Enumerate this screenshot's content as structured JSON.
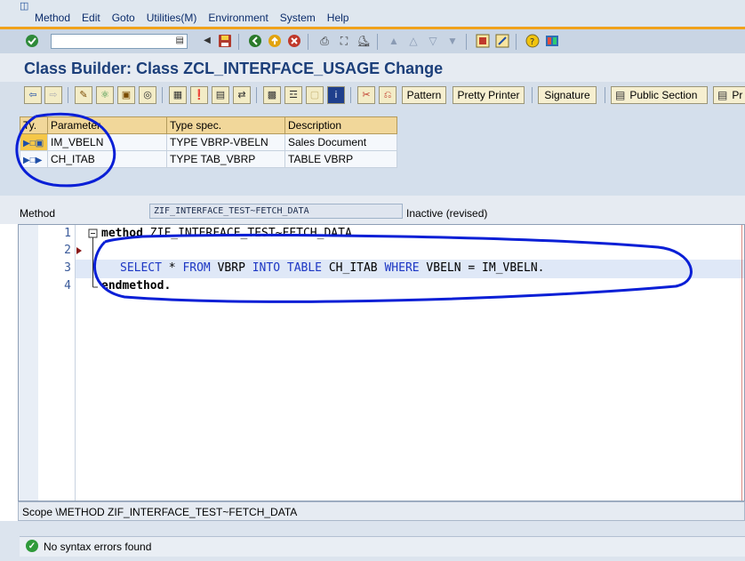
{
  "menu": {
    "items": [
      "Method",
      "Edit",
      "Goto",
      "Utilities(M)",
      "Environment",
      "System",
      "Help"
    ]
  },
  "toolbar": {
    "command_value": ""
  },
  "title": "Class Builder: Class ZCL_INTERFACE_USAGE Change",
  "app_toolbar": {
    "pattern": "Pattern",
    "pretty_printer": "Pretty Printer",
    "signature": "Signature",
    "public_section": "Public Section",
    "pr_cut": "Pr"
  },
  "params": {
    "headers": [
      "Ty.",
      "Parameter",
      "Type spec.",
      "Description"
    ],
    "rows": [
      {
        "parameter": "IM_VBELN",
        "type_spec": "TYPE VBRP-VBELN",
        "description": "Sales Document"
      },
      {
        "parameter": "CH_ITAB",
        "type_spec": "TYPE TAB_VBRP",
        "description": "TABLE VBRP"
      }
    ]
  },
  "method_row": {
    "label": "Method",
    "method_name": "ZIF_INTERFACE_TEST~FETCH_DATA",
    "status": "Inactive (revised)"
  },
  "editor": {
    "line_numbers": [
      "1",
      "2",
      "3",
      "4"
    ],
    "line1_kw": "method",
    "line1_rest": " ZIF_INTERFACE_TEST~FETCH_DATA.",
    "line3": {
      "t1": "SELECT",
      "t2": " * ",
      "t3": "FROM",
      "t4": " VBRP ",
      "t5": "INTO TABLE",
      "t6": " CH_ITAB ",
      "t7": "WHERE",
      "t8": " VBELN = IM_VBELN."
    },
    "line4": "endmethod."
  },
  "scope": "Scope \\METHOD ZIF_INTERFACE_TEST~FETCH_DATA",
  "status_message": "No syntax errors found",
  "colors": {
    "annotation": "#0a1fd6",
    "orange_stripe": "#f0a21b"
  }
}
